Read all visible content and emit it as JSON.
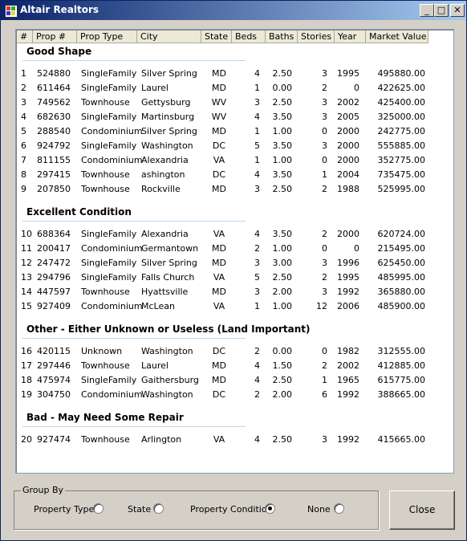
{
  "window": {
    "title": "Altair Realtors",
    "min_label": "_",
    "max_label": "□",
    "close_label": "✕"
  },
  "list": {
    "columns": [
      "#",
      "Prop #",
      "Prop Type",
      "City",
      "State",
      "Beds",
      "Baths",
      "Stories",
      "Year",
      "Market Value"
    ],
    "groups": [
      {
        "name": "Good Shape",
        "rows": [
          [
            "1",
            "524880",
            "SingleFamily",
            "Silver Spring",
            "MD",
            "4",
            "2.50",
            "3",
            "1995",
            "495880.00"
          ],
          [
            "2",
            "611464",
            "SingleFamily",
            "Laurel",
            "MD",
            "1",
            "0.00",
            "2",
            "0",
            "422625.00"
          ],
          [
            "3",
            "749562",
            "Townhouse",
            "Gettysburg",
            "WV",
            "3",
            "2.50",
            "3",
            "2002",
            "425400.00"
          ],
          [
            "4",
            "682630",
            "SingleFamily",
            "Martinsburg",
            "WV",
            "4",
            "3.50",
            "3",
            "2005",
            "325000.00"
          ],
          [
            "5",
            "288540",
            "Condominium",
            "Silver Spring",
            "MD",
            "1",
            "1.00",
            "0",
            "2000",
            "242775.00"
          ],
          [
            "6",
            "924792",
            "SingleFamily",
            "Washington",
            "DC",
            "5",
            "3.50",
            "3",
            "2000",
            "555885.00"
          ],
          [
            "7",
            "811155",
            "Condominium",
            "Alexandria",
            "VA",
            "1",
            "1.00",
            "0",
            "2000",
            "352775.00"
          ],
          [
            "8",
            "297415",
            "Townhouse",
            "ashington",
            "DC",
            "4",
            "3.50",
            "1",
            "2004",
            "735475.00"
          ],
          [
            "9",
            "207850",
            "Townhouse",
            "Rockville",
            "MD",
            "3",
            "2.50",
            "2",
            "1988",
            "525995.00"
          ]
        ]
      },
      {
        "name": "Excellent Condition",
        "rows": [
          [
            "10",
            "688364",
            "SingleFamily",
            "Alexandria",
            "VA",
            "4",
            "3.50",
            "2",
            "2000",
            "620724.00"
          ],
          [
            "11",
            "200417",
            "Condominium",
            "Germantown",
            "MD",
            "2",
            "1.00",
            "0",
            "0",
            "215495.00"
          ],
          [
            "12",
            "247472",
            "SingleFamily",
            "Silver Spring",
            "MD",
            "3",
            "3.00",
            "3",
            "1996",
            "625450.00"
          ],
          [
            "13",
            "294796",
            "SingleFamily",
            "Falls Church",
            "VA",
            "5",
            "2.50",
            "2",
            "1995",
            "485995.00"
          ],
          [
            "14",
            "447597",
            "Townhouse",
            "Hyattsville",
            "MD",
            "3",
            "2.00",
            "3",
            "1992",
            "365880.00"
          ],
          [
            "15",
            "927409",
            "Condominium",
            "McLean",
            "VA",
            "1",
            "1.00",
            "12",
            "2006",
            "485900.00"
          ]
        ]
      },
      {
        "name": "Other - Either Unknown or Useless (Land Important)",
        "rows": [
          [
            "16",
            "420115",
            "Unknown",
            "Washington",
            "DC",
            "2",
            "0.00",
            "0",
            "1982",
            "312555.00"
          ],
          [
            "17",
            "297446",
            "Townhouse",
            "Laurel",
            "MD",
            "4",
            "1.50",
            "2",
            "2002",
            "412885.00"
          ],
          [
            "18",
            "475974",
            "SingleFamily",
            "Gaithersburg",
            "MD",
            "4",
            "2.50",
            "1",
            "1965",
            "615775.00"
          ],
          [
            "19",
            "304750",
            "Condominium",
            "Washington",
            "DC",
            "2",
            "2.00",
            "6",
            "1992",
            "388665.00"
          ]
        ]
      },
      {
        "name": "Bad - May Need Some Repair",
        "rows": [
          [
            "20",
            "927474",
            "Townhouse",
            "Arlington",
            "VA",
            "4",
            "2.50",
            "3",
            "1992",
            "415665.00"
          ]
        ]
      }
    ]
  },
  "group_by": {
    "label": "Group By",
    "options": [
      {
        "label": "Property Type",
        "checked": false
      },
      {
        "label": "State",
        "checked": false
      },
      {
        "label": "Property Condition",
        "checked": true
      },
      {
        "label": "None",
        "checked": false
      }
    ]
  },
  "close_button": "Close"
}
